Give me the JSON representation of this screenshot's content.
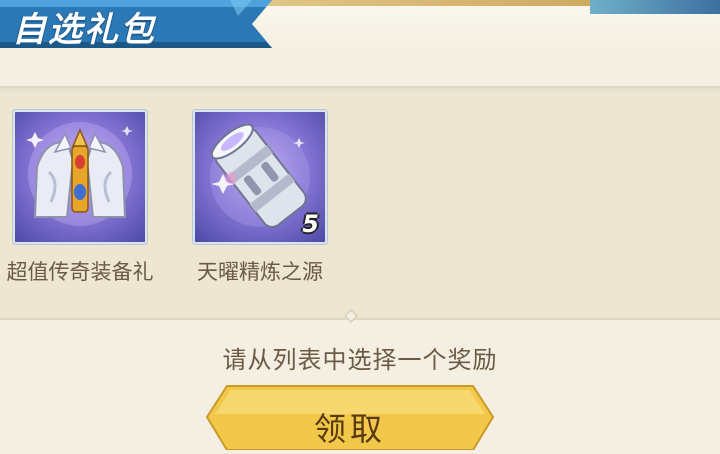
{
  "header": {
    "title": "自选礼包"
  },
  "rewards": [
    {
      "name": "超值传奇装备礼",
      "icon": "legendary-armor-icon",
      "count": ""
    },
    {
      "name": "天曜精炼之源",
      "icon": "refine-cylinder-icon",
      "count": "5"
    }
  ],
  "prompt": "请从列表中选择一个奖励",
  "claim_button": {
    "label": "领取"
  },
  "colors": {
    "banner": "#2a78b5",
    "background": "#f4efe2",
    "text": "#6b5a44",
    "button": "#f2c84b"
  }
}
